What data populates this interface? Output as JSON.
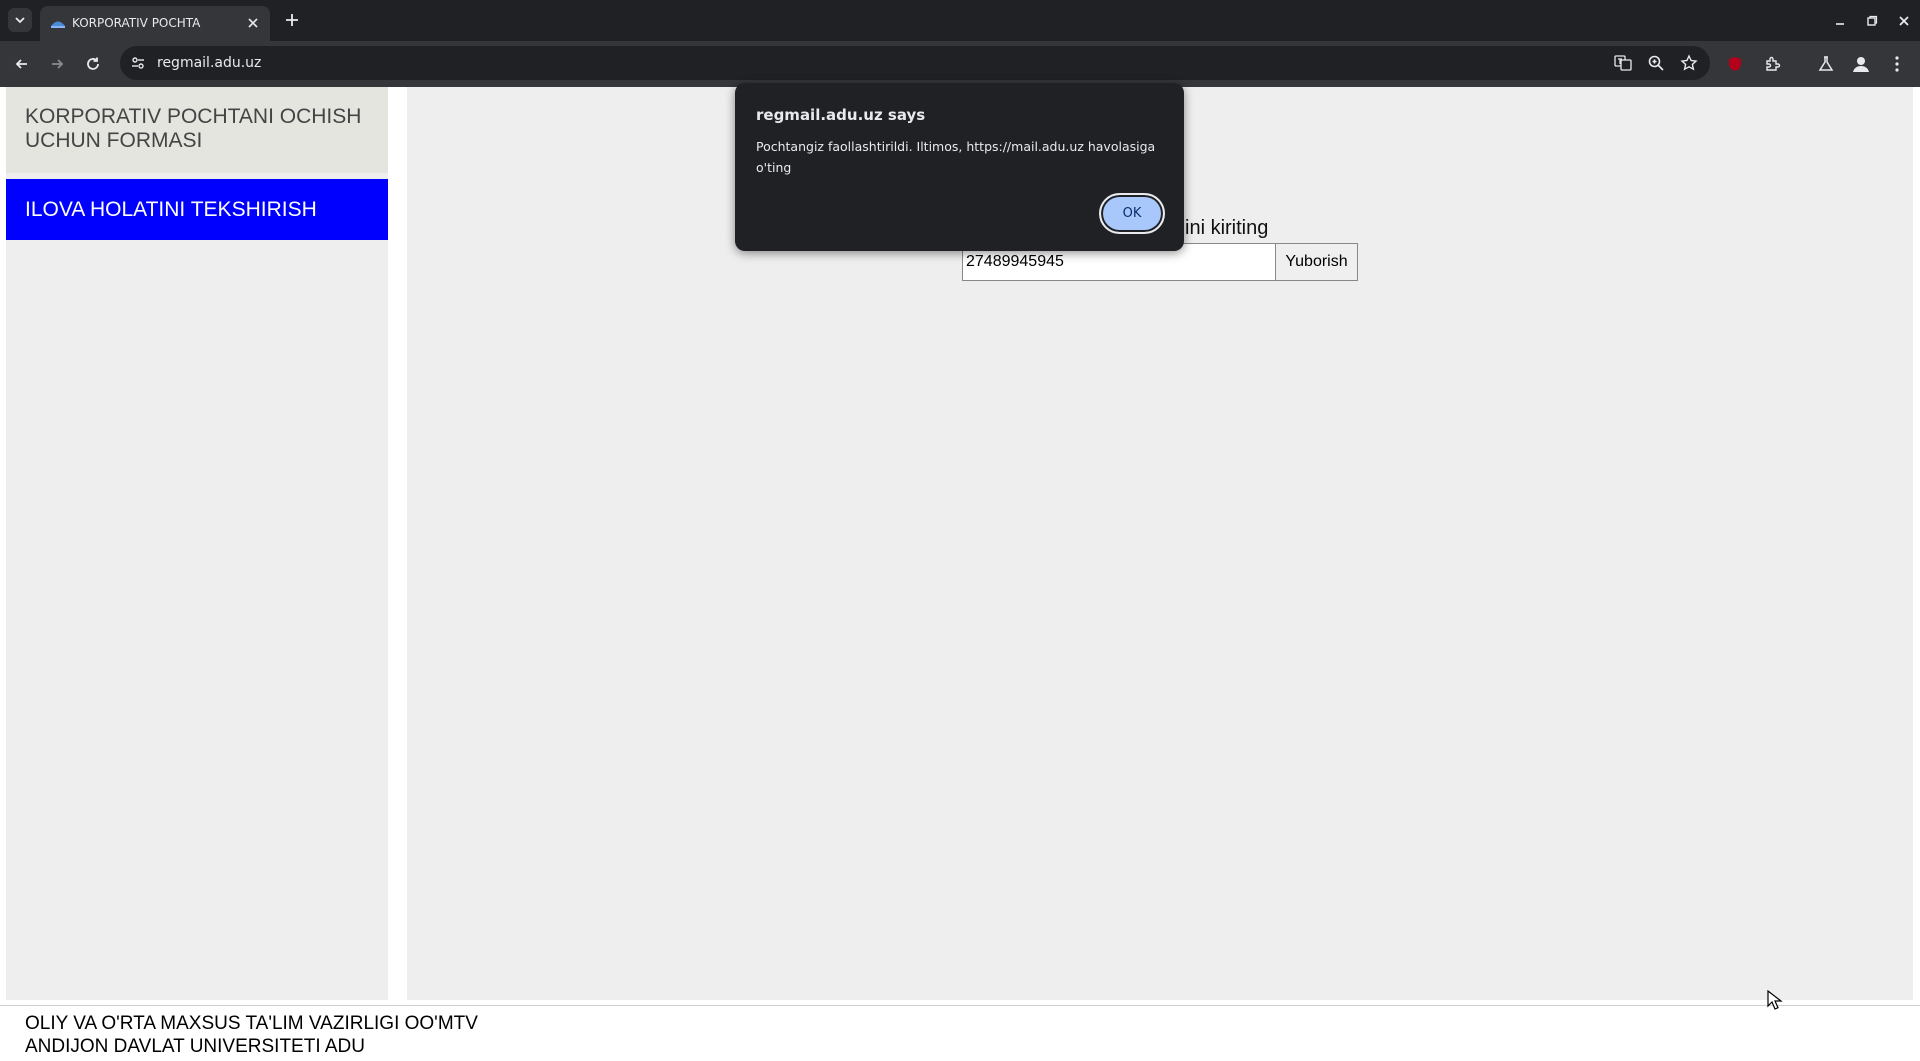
{
  "browser": {
    "tab": {
      "title": "KORPORATIV POCHTA"
    },
    "address_bar": {
      "url": "regmail.adu.uz"
    }
  },
  "sidebar": {
    "heading": "KORPORATIV POCHTANI OCHISH UCHUN FORMASI",
    "active_item": "ILOVA HOLATINI TEKSHIRISH"
  },
  "main": {
    "prompt_label": "ini kiriting",
    "id_input": {
      "value": "27489945945"
    },
    "send_label": "Yuborish"
  },
  "footer": {
    "line1": "OLIY VA O'RTA MAXSUS TA'LIM VAZIRLIGI OO'MTV",
    "line2": "ANDIJON DAVLAT UNIVERSITETI ADU"
  },
  "dialog": {
    "title": "regmail.adu.uz says",
    "message": "Pochtangiz faollashtirildi. Iltimos, https://mail.adu.uz havolasiga o'ting",
    "ok_label": "OK"
  },
  "colors": {
    "sidebar_active": "#0000ff",
    "ok_button": "#a8c7fa",
    "chrome_dark": "#202124"
  }
}
